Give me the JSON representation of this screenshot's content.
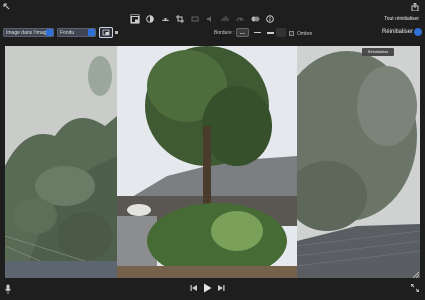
{
  "toolbar": {
    "reset_all_label": "Tout réinitialiser",
    "tools": [
      "pip-layout-icon",
      "color-balance-icon",
      "color-correction-icon",
      "crop-icon",
      "stabilization-icon",
      "volume-icon",
      "noise-reduction-icon",
      "speed-icon",
      "filter-icon",
      "info-icon"
    ]
  },
  "options": {
    "overlay_select": "Image dans l'image",
    "transition_select": "Fondu",
    "border_label": "Bordure :",
    "shadow_label": "Ombre",
    "reset_label": "Réinitialiser",
    "tooltip": "Réinitialiser"
  },
  "colors": {
    "accent": "#2f6fd8",
    "background": "#1e1e1e"
  }
}
